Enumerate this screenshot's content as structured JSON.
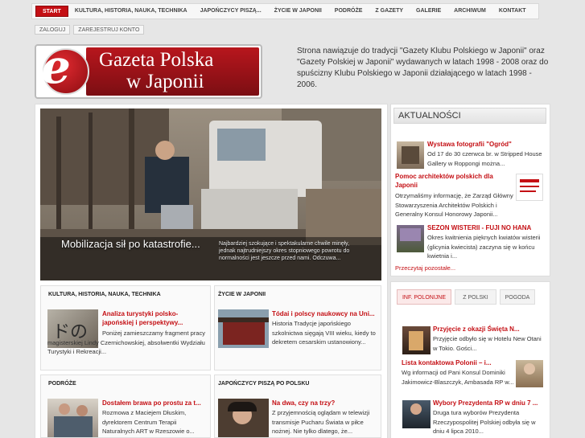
{
  "nav": {
    "items": [
      "START",
      "KULTURA, HISTORIA, NAUKA, TECHNIKA",
      "JAPOŃCZYCY PISZĄ...",
      "ŻYCIE W JAPONII",
      "PODRÓŻE",
      "Z GAZETY",
      "GALERIE",
      "ARCHIWUM",
      "KONTAKT"
    ],
    "active": "START"
  },
  "subnav": {
    "login": "ZALOGUJ",
    "register": "ZAREJESTRUJ KONTO"
  },
  "logo": {
    "line1": "Gazeta Polska",
    "line2": "w Japonii",
    "letter": "e"
  },
  "intro": "Strona nawiązuje do tradycji \"Gazety Klubu Polskiego w Japonii\" oraz \"Gazety Polskiej w Japonii\" wydawanych w latach 1998 - 2008 oraz do spuścizny Klubu Polskiego w Japonii działającego w latach 1998 - 2006.",
  "slide": {
    "caption": "Mobilizacja sił po katastrofie...",
    "description": "Najbardziej szokujące i spektakularne chwile minęły, jednak najtrudniejszy okres stopniowego powrotu do normalności jest jeszcze przed nami. Odczuwa..."
  },
  "sections": {
    "kultura": {
      "title": "KULTURA, HISTORIA, NAUKA, TECHNIKA",
      "article_title": "Analiza turystyki polsko-japońskiej i perspektywy...",
      "article_text": "Poniżej zamieszczamy fragment pracy magisterskiej Lindy Czernichowskiej, absolwentki Wydziału Turystyki i Rekreacji..."
    },
    "zycie": {
      "title": "ŻYCIE W JAPONII",
      "article_title": "Tódai i polscy naukowcy na Uni...",
      "article_text": "Historia Tradycje japońskiego szkolnictwa sięgają VIII wieku, kiedy to dekretem cesarskim ustanowiony..."
    },
    "podroze": {
      "title": "PODRÓŻE",
      "article_title": "Dostałem brawa po prostu za t...",
      "article_text": "Rozmowa z Maciejem Dłuskim, dyrektorem Centrum Terapii Naturalnych ART w Rzeszowie o..."
    },
    "japonczycy": {
      "title": "JAPOŃCZYCY PISZĄ PO POLSKU",
      "article_title": "Na dwa, czy na trzy?",
      "article_text": "Z przyjemnością oglądam w telewizji transmisje Pucharu Świata w piłce nożnej. Nie tylko dlatego, że..."
    }
  },
  "aktualnosci": {
    "heading": "AKTUALNOŚCI",
    "items": [
      {
        "title": "Wystawa fotografii \"Ogród\"",
        "text": "Od 17 do 30 czerwca br. w Stripped House Gallery w Roppongi można..."
      },
      {
        "title": "Pomoc architektów polskich dla Japonii",
        "text": "Otrzymaliśmy informację, że Zarząd Główny Stowarzyszenia Architektów Polskich i Generalny Konsul Honorowy Japonii..."
      },
      {
        "title": "SEZON WISTERII - FUJI NO HANA",
        "text": "Okres kwitnienia pięknych kwiatów wisterii (glicynia kwiecista) zaczyna się w końcu kwietnia i..."
      }
    ],
    "more": "Przeczytaj pozostałe..."
  },
  "tabs": {
    "items": [
      "INF. POLONIJNE",
      "Z POLSKI",
      "POGODA"
    ],
    "active": "INF. POLONIJNE",
    "articles": [
      {
        "title": "Przyjęcie z okazji Święta N...",
        "text": "Przyjęcie odbyło się w Hotelu New Otani w Tokio. Gości..."
      },
      {
        "title": "Lista kontaktowa Polonii – i...",
        "text": "Wg informacji od Pani Konsul Dominiki Jakimowicz-Blaszczyk, Ambasada RP w..."
      },
      {
        "title": "Wybory Prezydenta RP w dniu 7 ...",
        "text": "Druga tura wyborów Prezydenta Rzeczypospolitej Polskiej odbyła się w dniu 4 lipca 2010..."
      }
    ]
  },
  "colors": {
    "accent": "#c40f14",
    "background": "#e6e6e6"
  }
}
